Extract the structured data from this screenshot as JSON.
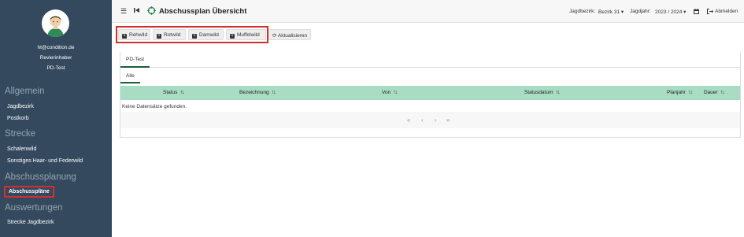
{
  "sidebar": {
    "user": {
      "email": "ht@condition.de",
      "role": "Revierinhaber",
      "account": "PD-Test"
    },
    "sections": [
      {
        "title": "Allgemein",
        "items": [
          "Jagdbezirk",
          "Postkorb"
        ]
      },
      {
        "title": "Strecke",
        "items": [
          "Schalenwild",
          "Sonstiges Haar- und Federwild"
        ]
      },
      {
        "title": "Abschussplanung",
        "items": [
          "Abschusspläne"
        ]
      },
      {
        "title": "Auswertungen",
        "items": [
          "Strecke Jagdbezirk"
        ]
      }
    ],
    "active_item": "Abschusspläne"
  },
  "header": {
    "title": "Abschussplan Übersicht",
    "jagdbezirk_label": "Jagdbezirk:",
    "jagdbezirk_value": "Bezirk 31",
    "jagdjahr_label": "Jagdjahr:",
    "jagdjahr_value": "2023 / 2024",
    "logout_label": "Abmelden",
    "icons": [
      "menu-icon",
      "skip-back-icon",
      "crosshair-logo-icon",
      "calendar-icon",
      "logout-icon"
    ]
  },
  "toolbar": {
    "buttons": [
      "Rehwild",
      "Rotwild",
      "Damwild",
      "Muffelwild"
    ],
    "refresh_label": "Aktualisieren"
  },
  "tabs": {
    "top": "PD-Test",
    "sub": "Alle"
  },
  "table": {
    "columns": [
      "Status",
      "Bezeichnung",
      "Von",
      "Statusdatum",
      "Planjahr",
      "Dauer"
    ],
    "empty_message": "Keine Datensätze gefunden.",
    "pager": [
      "«",
      "‹",
      "›",
      "»"
    ]
  },
  "colors": {
    "sidebar_bg": "#34495e",
    "table_header": "#a8dcc3",
    "accent": "#1a5e3a",
    "highlight": "#d32f2f"
  }
}
